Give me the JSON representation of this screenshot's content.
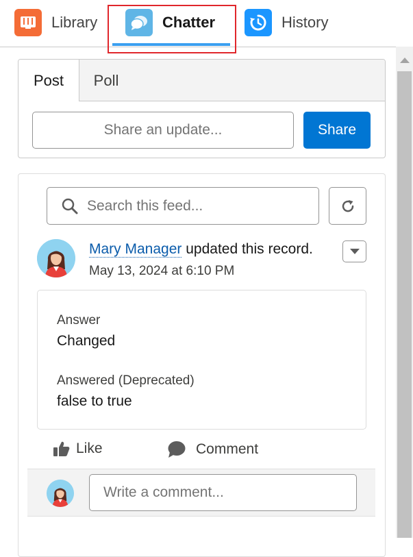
{
  "tabs": [
    {
      "label": "Library",
      "icon": "book-icon",
      "color": "#f46c36"
    },
    {
      "label": "Chatter",
      "icon": "chat-bubbles-icon",
      "color": "#5fb5e6",
      "active": true
    },
    {
      "label": "History",
      "icon": "history-icon",
      "color": "#1b96ff"
    }
  ],
  "publisher": {
    "tabs": [
      "Post",
      "Poll"
    ],
    "active_tab": "Post",
    "share_placeholder": "Share an update...",
    "share_button": "Share"
  },
  "feed": {
    "search_placeholder": "Search this feed...",
    "post": {
      "author": "Mary Manager",
      "action_text": " updated this record.",
      "timestamp": "May 13, 2024 at 6:10 PM",
      "changes": [
        {
          "label": "Answer",
          "value": "Changed"
        },
        {
          "label": "Answered (Deprecated)",
          "value": "false to true"
        }
      ],
      "like_label": "Like",
      "comment_label": "Comment"
    },
    "comment_placeholder": "Write a comment..."
  },
  "colors": {
    "brand_blue": "#0176d3",
    "link_blue": "#0b5cab",
    "highlight_red": "#e0262b",
    "active_tab_underline": "#3b9ff0"
  }
}
